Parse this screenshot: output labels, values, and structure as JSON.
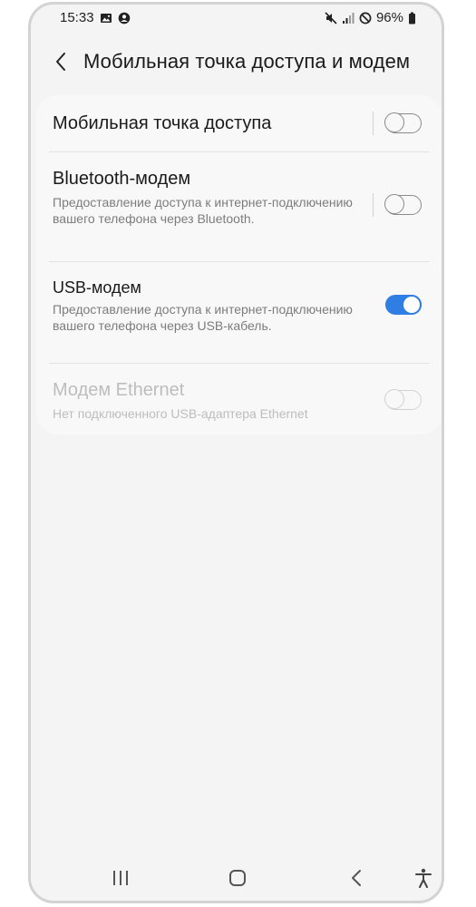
{
  "status_bar": {
    "time": "15:33",
    "battery": "96%",
    "icons_left": [
      "gallery-icon",
      "account-icon"
    ],
    "icons_right": [
      "mute-icon",
      "signal-icon",
      "do-not-disturb-icon",
      "battery-icon"
    ]
  },
  "header": {
    "title": "Мобильная точка доступа и модем",
    "back_icon": "chevron-left-icon"
  },
  "settings": [
    {
      "title": "Мобильная точка доступа",
      "subtitle": "",
      "toggle": "off",
      "enabled": true
    },
    {
      "title": "Bluetooth-модем",
      "subtitle": "Предоставление доступа к интернет-подключению вашего телефона через Bluetooth.",
      "toggle": "off",
      "enabled": true
    },
    {
      "title": "USB-модем",
      "subtitle": "Предоставление доступа к интернет-подключению вашего телефона через USB-кабель.",
      "toggle": "on",
      "enabled": true
    },
    {
      "title": "Модем Ethernet",
      "subtitle": "Нет подключенного USB-адаптера Ethernet",
      "toggle": "off",
      "enabled": false
    }
  ],
  "nav_bar": {
    "buttons": [
      "recent-apps-icon",
      "home-icon",
      "back-icon",
      "accessibility-icon"
    ]
  },
  "colors": {
    "accent": "#2f7ee4",
    "background": "#f4f4f4",
    "card": "#f8f8f8",
    "subtitle": "#7c7c7c",
    "disabled": "#bdbdbd"
  }
}
